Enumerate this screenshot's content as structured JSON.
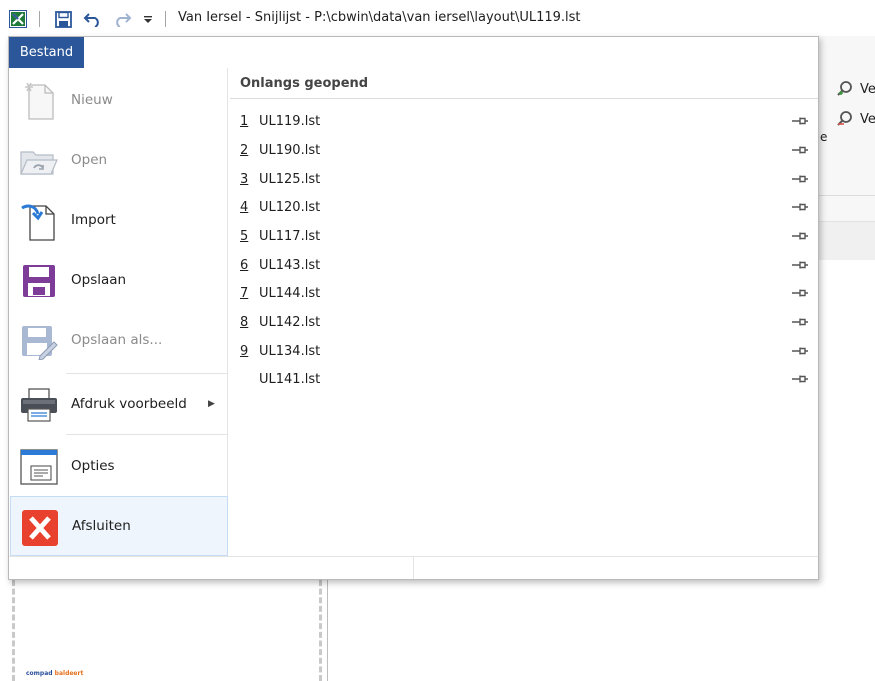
{
  "window": {
    "title": "Van Iersel - Snijlijst - P:\\cbwin\\data\\van iersel\\layout\\UL119.lst",
    "quick_access": [
      "app-icon",
      "save-icon",
      "undo-icon",
      "redo-icon",
      "customize-qat-icon"
    ]
  },
  "file_tab": {
    "label": "Bestand"
  },
  "menu": {
    "items": [
      {
        "label": "Nieuw",
        "icon": "new-document-icon",
        "enabled": false
      },
      {
        "label": "Open",
        "icon": "open-folder-icon",
        "enabled": false
      },
      {
        "label": "Import",
        "icon": "import-icon",
        "enabled": true
      },
      {
        "label": "Opslaan",
        "icon": "save-floppy-icon",
        "enabled": true
      },
      {
        "label": "Opslaan als...",
        "icon": "save-as-icon",
        "enabled": false
      },
      {
        "label": "Afdruk voorbeeld",
        "icon": "printer-icon",
        "enabled": true,
        "submenu": true
      },
      {
        "label": "Opties",
        "icon": "options-window-icon",
        "enabled": true
      },
      {
        "label": "Afsluiten",
        "icon": "exit-icon",
        "enabled": true,
        "selected": true
      }
    ]
  },
  "recent": {
    "header": "Onlangs geopend",
    "files": [
      {
        "num": "1",
        "name": "UL119.lst"
      },
      {
        "num": "2",
        "name": "UL190.lst"
      },
      {
        "num": "3",
        "name": "UL125.lst"
      },
      {
        "num": "4",
        "name": "UL120.lst"
      },
      {
        "num": "5",
        "name": "UL117.lst"
      },
      {
        "num": "6",
        "name": "UL143.lst"
      },
      {
        "num": "7",
        "name": "UL144.lst"
      },
      {
        "num": "8",
        "name": "UL142.lst"
      },
      {
        "num": "9",
        "name": "UL134.lst"
      },
      {
        "num": "",
        "name": "UL141.lst"
      }
    ]
  },
  "background": {
    "find_1": "Ve",
    "find_2": "Ve",
    "partial_label": "e",
    "doc_logo_a": "compad",
    "doc_logo_b": "baldeert"
  },
  "colors": {
    "accent": "#2b579a",
    "selected_bg": "#eef5fc",
    "disabled_text": "#8a8a8a",
    "exit_red": "#e8412d",
    "save_purple": "#7d3c98"
  }
}
